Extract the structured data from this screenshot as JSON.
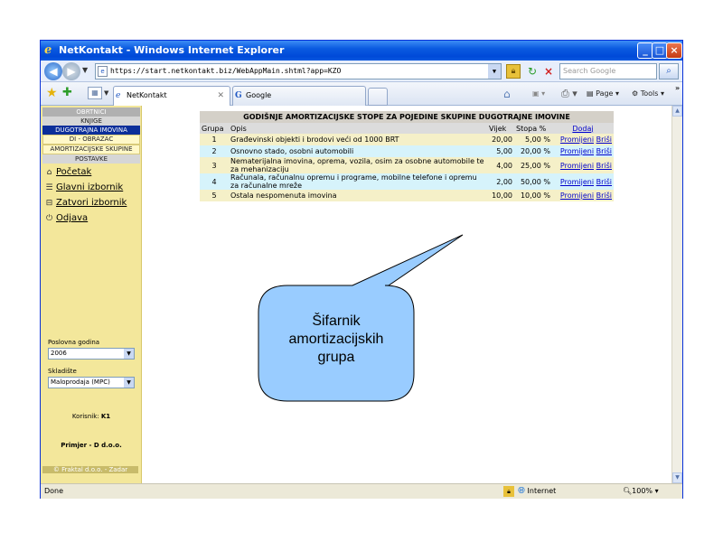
{
  "window": {
    "title": "NetKontakt - Windows Internet Explorer",
    "min_glyph": "_",
    "max_glyph": "□",
    "close_glyph": "×"
  },
  "addressbar": {
    "url": "https://start.netkontakt.biz/WebAppMain.shtml?app=KZO",
    "search_placeholder": "Search Google"
  },
  "tabs": [
    {
      "label": "NetKontakt",
      "icon": "ie-page-icon"
    },
    {
      "label": "Google",
      "icon": "google-icon"
    }
  ],
  "commandbar": {
    "page_label": "Page",
    "tools_label": "Tools",
    "chevron": "»"
  },
  "sidebar": {
    "sections": {
      "obrtnici": "OBRTNICI",
      "knjige": "KNJIGE",
      "dugotrajna": "DUGOTRAJNA IMOVINA",
      "di_obrazac": "DI - OBRAZAC",
      "amortizacijske": "AMORTIZACIJSKE SKUPINE",
      "postavke": "POSTAVKE"
    },
    "links": [
      {
        "label": "Početak",
        "icon": "home-icon"
      },
      {
        "label": "Glavni izbornik",
        "icon": "menu-icon"
      },
      {
        "label": "Zatvori izbornik",
        "icon": "close-menu-icon"
      },
      {
        "label": "Odjava",
        "icon": "logout-icon"
      }
    ],
    "poslovna_godina_label": "Poslovna godina",
    "poslovna_godina_value": "2006",
    "skladiste_label": "Skladište",
    "skladiste_value": "Maloprodaja (MPC)",
    "korisnik_label": "Korisnik:",
    "korisnik_value": "K1",
    "company": "Primjer - D d.o.o.",
    "copyright": "© Fraktal d.o.o. - Zadar"
  },
  "table": {
    "caption": "GODIŠNJE AMORTIZACIJSKE STOPE ZA POJEDINE SKUPINE DUGOTRAJNE IMOVINE",
    "headers": {
      "grupa": "Grupa",
      "opis": "Opis",
      "vijek": "Vijek",
      "stopa": "Stopa %",
      "dodaj": "Dodaj"
    },
    "rows": [
      {
        "grupa": "1",
        "opis": "Građevinski objekti i brodovi veći od 1000 BRT",
        "vijek": "20,00",
        "stopa": "5,00 %",
        "edit": "Promijeni",
        "del": "Briši"
      },
      {
        "grupa": "2",
        "opis": "Osnovno stado, osobni automobili",
        "vijek": "5,00",
        "stopa": "20,00 %",
        "edit": "Promijeni",
        "del": "Briši"
      },
      {
        "grupa": "3",
        "opis": "Nematerijalna imovina, oprema, vozila, osim za osobne automobile te za mehanizaciju",
        "vijek": "4,00",
        "stopa": "25,00 %",
        "edit": "Promijeni",
        "del": "Briši"
      },
      {
        "grupa": "4",
        "opis": "Računala, računalnu opremu i programe, mobilne telefone i opremu za računalne mreže",
        "vijek": "2,00",
        "stopa": "50,00 %",
        "edit": "Promijeni",
        "del": "Briši"
      },
      {
        "grupa": "5",
        "opis": "Ostala nespomenuta imovina",
        "vijek": "10,00",
        "stopa": "10,00 %",
        "edit": "Promijeni",
        "del": "Briši"
      }
    ]
  },
  "callout": {
    "line1": "Šifarnik",
    "line2": "amortizacijskih",
    "line3": "grupa",
    "fill": "#99ccff",
    "stroke": "#000000"
  },
  "statusbar": {
    "done": "Done",
    "zone": "Internet",
    "zoom": "100%"
  },
  "colors": {
    "sidebar_bg": "#f3e79b",
    "row_odd": "#f5f0c8",
    "row_even": "#d6f3fb",
    "link": "#0000cc",
    "active_section": "#0c2f9a"
  }
}
